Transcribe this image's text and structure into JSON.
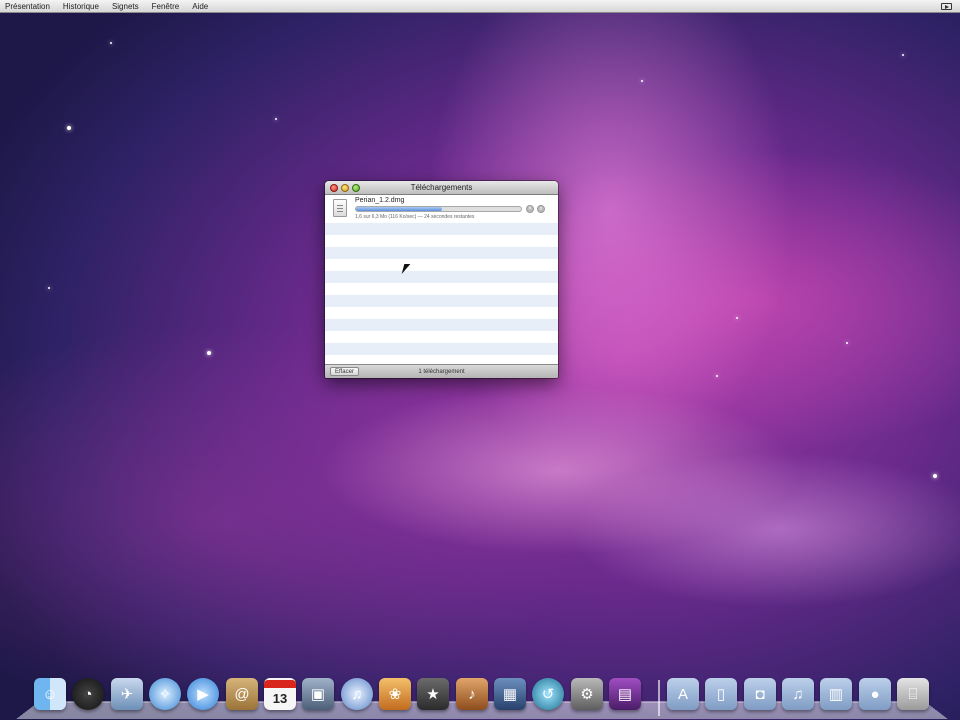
{
  "menubar": {
    "items": [
      "Présentation",
      "Historique",
      "Signets",
      "Fenêtre",
      "Aide"
    ],
    "status_icon": "screen-record-icon"
  },
  "downloads_window": {
    "title": "Téléchargements",
    "file": {
      "name": "Perian_1.2.dmg",
      "status": "1,6 sur 6,3 Mo (116 Ko/sec) — 24 secondes restantes",
      "progress_fraction": 0.52
    },
    "footer": {
      "clear_label": "Effacer",
      "count_label": "1 téléchargement"
    }
  },
  "dock": {
    "items": [
      {
        "name": "finder",
        "icon": "finder-icon"
      },
      {
        "name": "dashboard",
        "icon": "dashboard-icon"
      },
      {
        "name": "mail",
        "icon": "mail-icon"
      },
      {
        "name": "safari",
        "icon": "safari-icon"
      },
      {
        "name": "ichat",
        "icon": "ichat-icon"
      },
      {
        "name": "address-book",
        "icon": "address-book-icon"
      },
      {
        "name": "ical",
        "icon": "ical-icon",
        "label": "13"
      },
      {
        "name": "preview",
        "icon": "preview-icon"
      },
      {
        "name": "itunes",
        "icon": "itunes-icon"
      },
      {
        "name": "iphoto",
        "icon": "iphoto-icon"
      },
      {
        "name": "imovie",
        "icon": "imovie-icon"
      },
      {
        "name": "garageband",
        "icon": "garageband-icon"
      },
      {
        "name": "spaces",
        "icon": "spaces-icon"
      },
      {
        "name": "time-machine",
        "icon": "time-machine-icon"
      },
      {
        "name": "system-preferences",
        "icon": "system-preferences-icon"
      },
      {
        "name": "photo-booth",
        "icon": "photo-booth-icon"
      },
      {
        "name": "applications-stack",
        "icon": "applications-folder-icon"
      },
      {
        "name": "documents-stack",
        "icon": "documents-folder-icon"
      },
      {
        "name": "pictures-stack",
        "icon": "pictures-folder-icon"
      },
      {
        "name": "music-stack",
        "icon": "music-folder-icon"
      },
      {
        "name": "movies-stack",
        "icon": "movies-folder-icon"
      },
      {
        "name": "downloads-stack",
        "icon": "downloads-folder-icon"
      },
      {
        "name": "trash",
        "icon": "trash-icon"
      }
    ]
  }
}
